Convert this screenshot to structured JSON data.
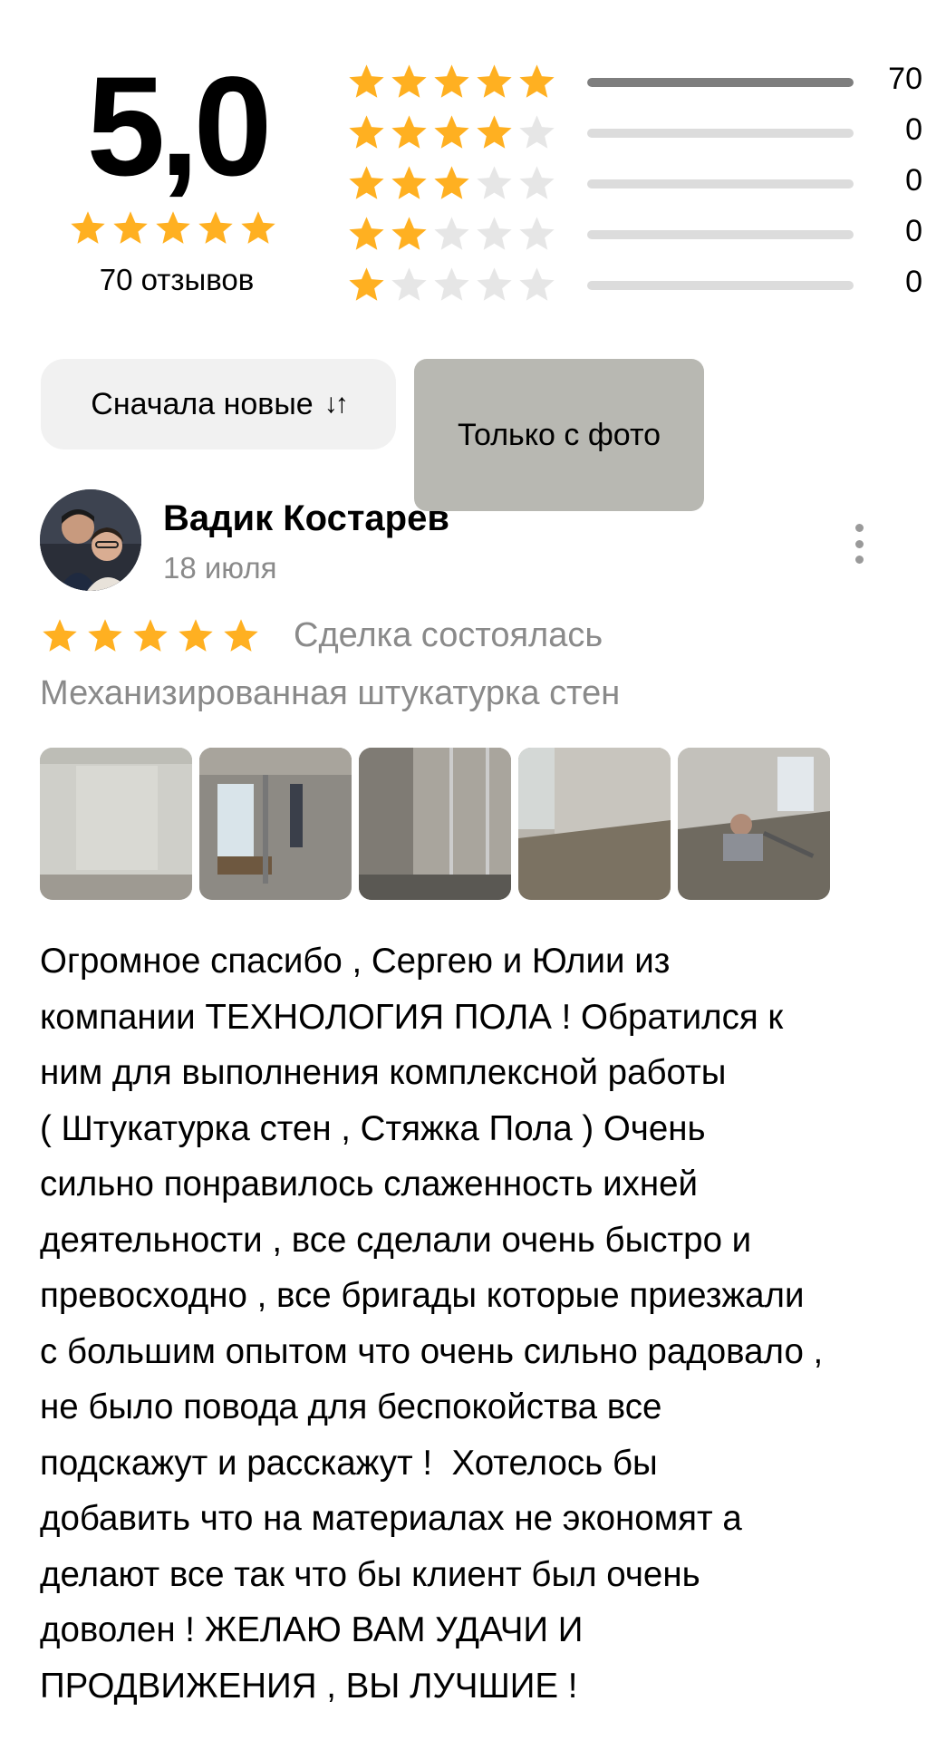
{
  "rating_summary": {
    "average": "5,0",
    "average_stars": 5,
    "reviews_count_label": "70 отзывов",
    "distribution": [
      {
        "stars": 5,
        "count": "70",
        "fraction": 1.0
      },
      {
        "stars": 4,
        "count": "0",
        "fraction": 0
      },
      {
        "stars": 3,
        "count": "0",
        "fraction": 0
      },
      {
        "stars": 2,
        "count": "0",
        "fraction": 0
      },
      {
        "stars": 1,
        "count": "0",
        "fraction": 0
      }
    ]
  },
  "filters": {
    "sort_label": "Сначала новые",
    "sort_icon": "sort-arrows-icon",
    "photo_only_label": "Только с фото"
  },
  "review": {
    "author": "Вадик Костарев",
    "date": "18 июля",
    "rating": 5,
    "deal_status": "Сделка состоялась",
    "service": "Механизированная штукатурка стен",
    "photos_count": 5,
    "text": "Огромное спасибо , Сергею и Юлии из\nкомпании ТЕХНОЛОГИЯ ПОЛА ! Обратился к\nним для выполнения комплексной работы\n( Штукатурка стен , Стяжка Пола ) Очень\nсильно понравилось слаженность ихней\nдеятельности , все сделали очень быстро и\nпревосходно , все бригады которые приезжали\nс большим опытом что очень сильно радовало ,\nне было повода для беспокойства все\nподскажут и расскажут !  Хотелось бы\nдобавить что на материалах не экономят а\nделают все так что бы клиент был очень\nдоволен ! ЖЕЛАЮ ВАМ УДАЧИ И\nПРОДВИЖЕНИЯ , ВЫ ЛУЧШИЕ !"
  },
  "colors": {
    "star_filled": "#FFB021",
    "star_empty": "#E6E6E6",
    "bar_fill": "#7E7E7E",
    "bar_track": "#DCDCDC",
    "chip_bg": "#F1F1F1",
    "muted_text": "#8A8A8A"
  }
}
